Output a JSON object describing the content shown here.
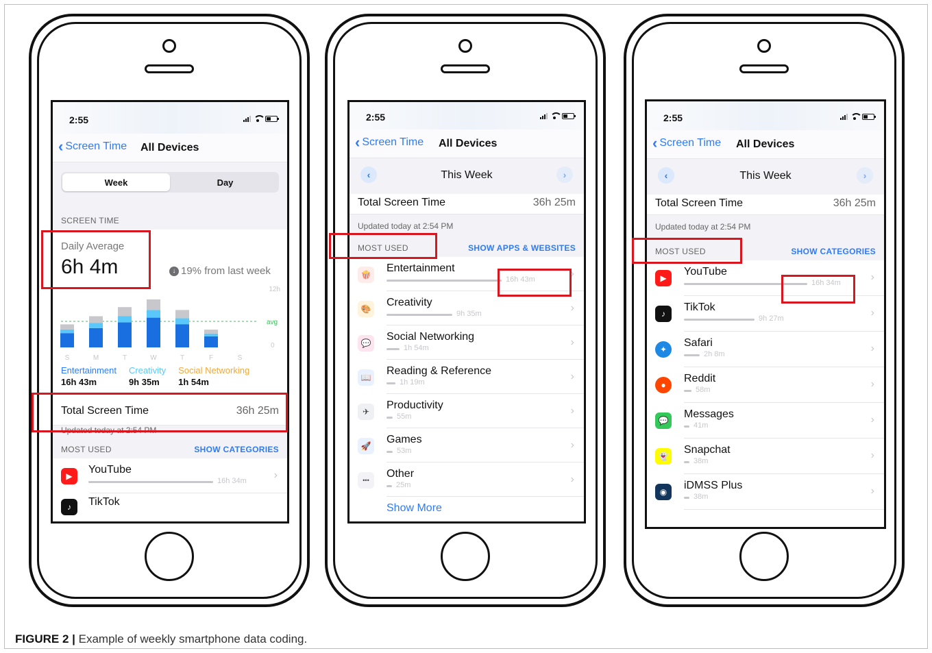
{
  "caption": {
    "label": "FIGURE 2 |",
    "text": "Example of weekly smartphone data coding."
  },
  "colors": {
    "accent": "#2f7bf6",
    "highlight_box": "#d9151f",
    "entertainment": "#1a6fe0",
    "creativity": "#5ac8fa",
    "social": "#f2a93b"
  },
  "phone1": {
    "time": "2:55",
    "back": "Screen Time",
    "title": "All Devices",
    "segment": {
      "week": "Week",
      "day": "Day"
    },
    "section_screen_time": "SCREEN TIME",
    "daily_avg_label": "Daily Average",
    "daily_avg_value": "6h 4m",
    "change_text": "19% from last week",
    "chart": {
      "y_top": "12h",
      "y_zero": "0",
      "avg_label": "avg",
      "days": [
        "S",
        "M",
        "T",
        "W",
        "T",
        "F",
        "S"
      ],
      "daily_hours": [
        4.8,
        6.5,
        8.4,
        10.0,
        7.8,
        3.7,
        0
      ]
    },
    "legend": [
      {
        "name": "Entertainment",
        "value": "16h 43m"
      },
      {
        "name": "Creativity",
        "value": "9h 35m"
      },
      {
        "name": "Social Networking",
        "value": "1h 54m"
      }
    ],
    "total_label": "Total Screen Time",
    "total_value": "36h 25m",
    "updated": "Updated today at 2:54 PM",
    "most_used": "MOST USED",
    "show_categories": "SHOW CATEGORIES",
    "apps": [
      {
        "name": "YouTube",
        "value": "16h 34m"
      },
      {
        "name": "TikTok"
      }
    ]
  },
  "phone2": {
    "time": "2:55",
    "back": "Screen Time",
    "title": "All Devices",
    "week_label": "This Week",
    "total_label": "Total Screen Time",
    "total_value": "36h 25m",
    "updated": "Updated today at 2:54 PM",
    "most_used": "MOST USED",
    "show_apps": "SHOW APPS & WEBSITES",
    "rows": [
      {
        "name": "Entertainment",
        "value": "16h 43m",
        "minutes": 1003,
        "icon": "popcorn-icon",
        "glyph": "🍿",
        "color": "#fdecea"
      },
      {
        "name": "Creativity",
        "value": "9h 35m",
        "minutes": 575,
        "icon": "palette-icon",
        "glyph": "🎨",
        "color": "#fff3dc"
      },
      {
        "name": "Social Networking",
        "value": "1h 54m",
        "minutes": 114,
        "icon": "chat-bubble-icon",
        "glyph": "💬",
        "color": "#fde4ef"
      },
      {
        "name": "Reading & Reference",
        "value": "1h 19m",
        "minutes": 79,
        "icon": "book-icon",
        "glyph": "📖",
        "color": "#e8f1fd"
      },
      {
        "name": "Productivity",
        "value": "55m",
        "minutes": 55,
        "icon": "paper-plane-icon",
        "glyph": "✈",
        "color": "#eef0f3"
      },
      {
        "name": "Games",
        "value": "53m",
        "minutes": 53,
        "icon": "rocket-icon",
        "glyph": "🚀",
        "color": "#e8f1fd"
      },
      {
        "name": "Other",
        "value": "25m",
        "minutes": 25,
        "icon": "more-dots-icon",
        "glyph": "•••",
        "color": "#f2f2f7"
      }
    ],
    "show_more": "Show More"
  },
  "phone3": {
    "time": "2:55",
    "back": "Screen Time",
    "title": "All Devices",
    "week_label": "This Week",
    "total_label": "Total Screen Time",
    "total_value": "36h 25m",
    "updated": "Updated today at 2:54 PM",
    "most_used": "MOST USED",
    "show_categories": "SHOW CATEGORIES",
    "apps": [
      {
        "name": "YouTube",
        "value": "16h 34m",
        "minutes": 994,
        "icon": "youtube-icon",
        "glyph": "▶",
        "color": "#ff1a1a"
      },
      {
        "name": "TikTok",
        "value": "9h 27m",
        "minutes": 567,
        "icon": "tiktok-icon",
        "glyph": "♪",
        "color": "#111111"
      },
      {
        "name": "Safari",
        "value": "2h 8m",
        "minutes": 128,
        "icon": "safari-icon",
        "glyph": "✦",
        "color": "#1e88e5"
      },
      {
        "name": "Reddit",
        "value": "58m",
        "minutes": 58,
        "icon": "reddit-icon",
        "glyph": "●",
        "color": "#ff4500"
      },
      {
        "name": "Messages",
        "value": "41m",
        "minutes": 41,
        "icon": "messages-icon",
        "glyph": "💬",
        "color": "#34c759"
      },
      {
        "name": "Snapchat",
        "value": "38m",
        "minutes": 38,
        "icon": "snapchat-icon",
        "glyph": "👻",
        "color": "#fffc00"
      },
      {
        "name": "iDMSS Plus",
        "value": "38m",
        "minutes": 38,
        "icon": "idmss-icon",
        "glyph": "◉",
        "color": "#12355b"
      }
    ]
  }
}
